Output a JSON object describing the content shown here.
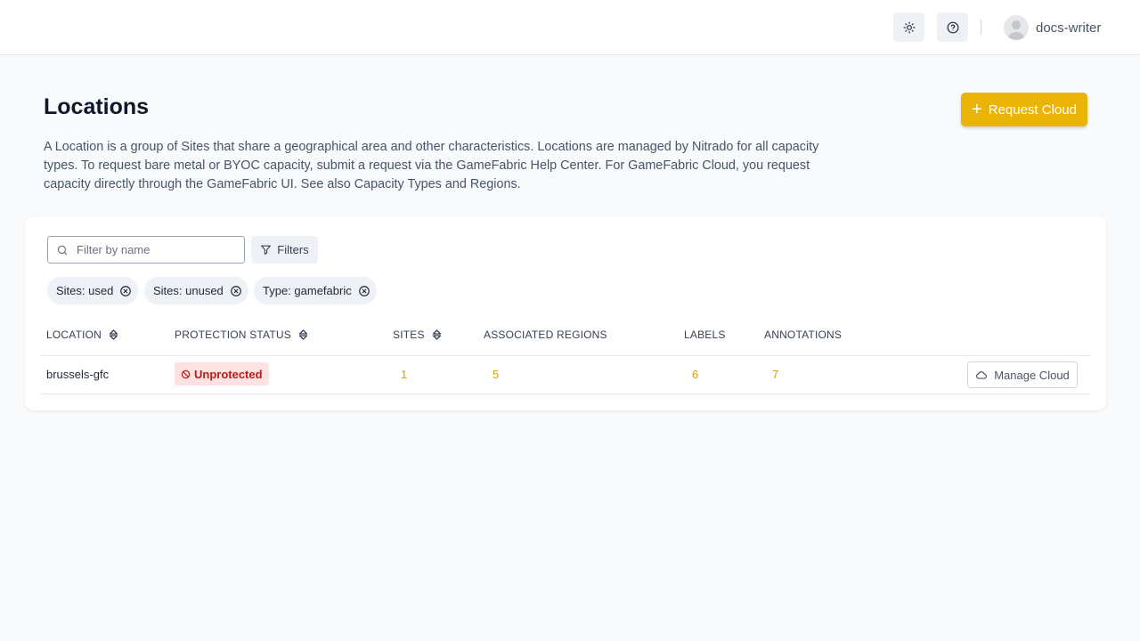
{
  "header": {
    "username": "docs-writer",
    "icons": [
      "sun-icon",
      "help-circle-icon",
      "user-avatar-icon"
    ]
  },
  "page": {
    "title": "Locations",
    "request_button_label": "Request Cloud",
    "description": "A Location is a group of Sites that share a geographical area and other characteristics. Locations are managed by Nitrado for all capacity types. To request bare metal or BYOC capacity, submit a request via the GameFabric Help Center. For GameFabric Cloud, you request capacity directly through the GameFabric UI. See also Capacity Types and Regions."
  },
  "toolbar": {
    "search_placeholder": "Filter by name",
    "filters_label": "Filters"
  },
  "active_filters": [
    {
      "label": "Sites: used"
    },
    {
      "label": "Sites: unused"
    },
    {
      "label": "Type: gamefabric"
    }
  ],
  "table": {
    "columns": [
      "LOCATION",
      "PROTECTION STATUS",
      "SITES",
      "ASSOCIATED REGIONS",
      "LABELS",
      "ANNOTATIONS"
    ],
    "rows": [
      {
        "location": "brussels-gfc",
        "protection_status": "Unprotected",
        "sites": "1",
        "associated_regions": "5",
        "labels": "6",
        "annotations": "7",
        "action_label": "Manage Cloud"
      }
    ]
  },
  "colors": {
    "accent": "#eab308",
    "badge_bg": "#fee2e2",
    "badge_text": "#b91c1c",
    "count_text": "#d4a20c"
  }
}
